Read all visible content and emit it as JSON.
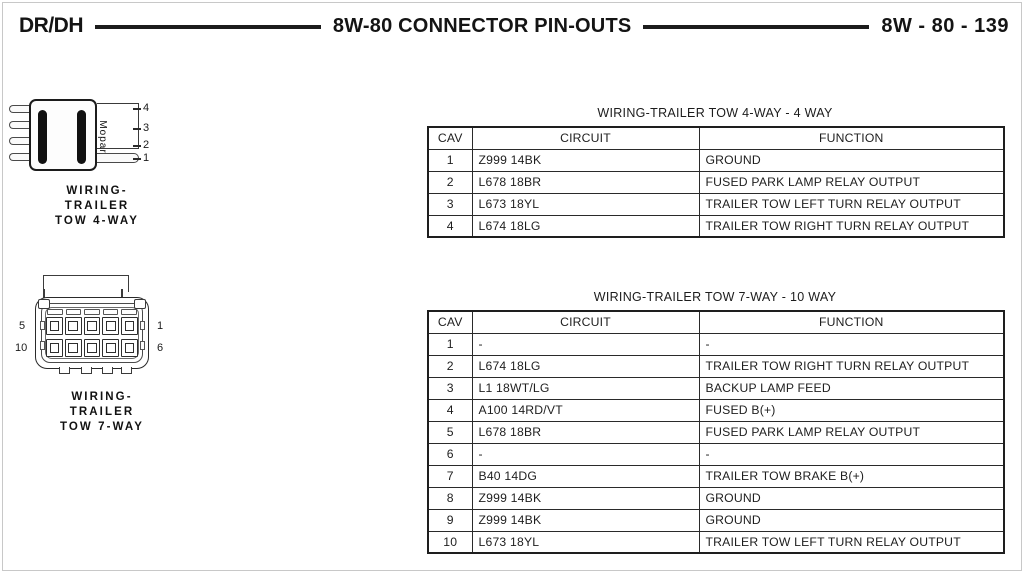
{
  "header": {
    "left_title": "DR/DH",
    "center_title": "8W-80 CONNECTOR PIN-OUTS",
    "right_code": "8W - 80 - 139"
  },
  "figures": [
    {
      "id": "wiring-trailer-tow-4-way",
      "caption_lines": [
        "WIRING-",
        "TRAILER",
        "TOW 4-WAY"
      ],
      "brand_text": "Mopar",
      "pin_labels": [
        "4",
        "3",
        "2",
        "1"
      ]
    },
    {
      "id": "wiring-trailer-tow-7-way",
      "caption_lines": [
        "WIRING-",
        "TRAILER",
        "TOW 7-WAY"
      ],
      "pin_labels": {
        "top_left": "5",
        "bottom_left": "10",
        "top_right": "1",
        "bottom_right": "6"
      }
    }
  ],
  "tables": [
    {
      "title": "WIRING-TRAILER TOW 4-WAY - 4 WAY",
      "columns": [
        "CAV",
        "CIRCUIT",
        "FUNCTION"
      ],
      "rows": [
        [
          "1",
          "Z999 14BK",
          "GROUND"
        ],
        [
          "2",
          "L678 18BR",
          "FUSED PARK LAMP RELAY OUTPUT"
        ],
        [
          "3",
          "L673 18YL",
          "TRAILER TOW LEFT TURN RELAY OUTPUT"
        ],
        [
          "4",
          "L674 18LG",
          "TRAILER TOW RIGHT TURN RELAY OUTPUT"
        ]
      ]
    },
    {
      "title": "WIRING-TRAILER TOW 7-WAY - 10 WAY",
      "columns": [
        "CAV",
        "CIRCUIT",
        "FUNCTION"
      ],
      "rows": [
        [
          "1",
          "-",
          "-"
        ],
        [
          "2",
          "L674 18LG",
          "TRAILER TOW RIGHT TURN RELAY OUTPUT"
        ],
        [
          "3",
          "L1 18WT/LG",
          "BACKUP LAMP FEED"
        ],
        [
          "4",
          "A100 14RD/VT",
          "FUSED B(+)"
        ],
        [
          "5",
          "L678 18BR",
          "FUSED PARK LAMP RELAY OUTPUT"
        ],
        [
          "6",
          "-",
          "-"
        ],
        [
          "7",
          "B40 14DG",
          "TRAILER TOW BRAKE B(+)"
        ],
        [
          "8",
          "Z999 14BK",
          "GROUND"
        ],
        [
          "9",
          "Z999 14BK",
          "GROUND"
        ],
        [
          "10",
          "L673 18YL",
          "TRAILER TOW LEFT TURN RELAY OUTPUT"
        ]
      ]
    }
  ]
}
